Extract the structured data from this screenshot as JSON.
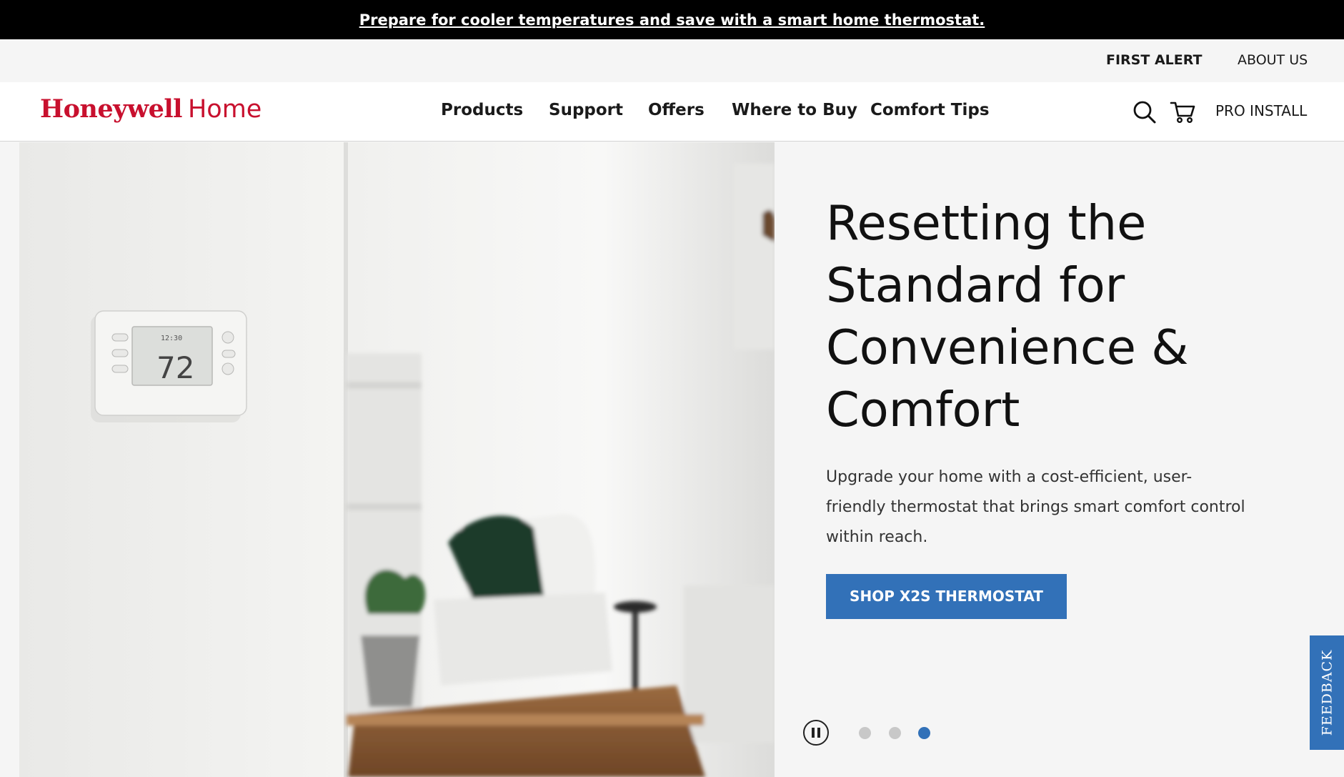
{
  "promo": {
    "text": "Prepare for cooler temperatures and save with a smart home thermostat."
  },
  "utility": {
    "first_alert": "FIRST ALERT",
    "about_us": "ABOUT US"
  },
  "logo": {
    "brand": "Honeywell",
    "home": "Home"
  },
  "nav": {
    "items": [
      {
        "label": "Products"
      },
      {
        "label": "Support"
      },
      {
        "label": "Offers"
      },
      {
        "label": "Where to Buy"
      },
      {
        "label": "Comfort Tips"
      }
    ],
    "pro_install": "PRO INSTALL"
  },
  "hero": {
    "title_lines": [
      "Resetting the",
      "Standard for",
      "Convenience &",
      "Comfort"
    ],
    "description": "Upgrade your home with a cost-efficient, user-friendly thermostat that brings smart comfort control within reach.",
    "cta_label": "SHOP X2S THERMOSTAT",
    "thermostat": {
      "temp": "72",
      "time": "12:30"
    }
  },
  "carousel": {
    "slide_count": 3,
    "active_slide": 3
  },
  "feedback": {
    "label": "FEEDBACK"
  },
  "colors": {
    "brand_red": "#c8102e",
    "accent_blue": "#3271b8",
    "promo_bg": "#000000"
  }
}
